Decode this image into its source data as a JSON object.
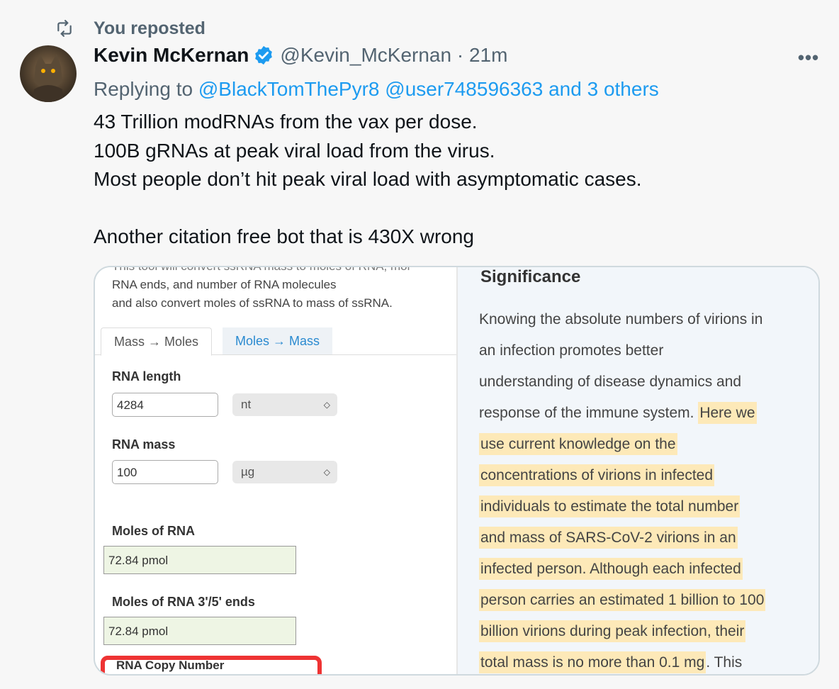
{
  "repost": {
    "text": "You reposted"
  },
  "author": {
    "name": "Kevin McKernan",
    "handle": "@Kevin_McKernan",
    "time_sep": " · ",
    "time": "21m"
  },
  "reply": {
    "prefix": "Replying to ",
    "mentions": [
      "@BlackTomThePyr8",
      "@user748596363",
      "and 3 others"
    ]
  },
  "tweet_lines": [
    "43 Trillion modRNAs from the vax per dose.",
    "100B gRNAs at peak viral load from the virus.",
    "Most people don’t hit peak viral load with asymptomatic cases.",
    "",
    "Another citation free bot that is 430X wrong"
  ],
  "media": {
    "calculator": {
      "intro_lines": [
        "This tool will convert ssRNA mass to moles of RNA, mol",
        "RNA ends, and number of RNA molecules",
        "and also convert moles of ssRNA to mass of ssRNA."
      ],
      "tabs": [
        "Mass → Moles",
        "Moles → Mass"
      ],
      "rna_length_label": "RNA length",
      "rna_length_value": "4284",
      "rna_length_unit": "nt",
      "rna_mass_label": "RNA mass",
      "rna_mass_value": "100",
      "rna_mass_unit": "µg",
      "moles_label": "Moles of RNA",
      "moles_value": "72.84 pmol",
      "ends_label": "Moles of RNA 3'/5' ends",
      "ends_value": "72.84 pmol",
      "copy_number_label": "RNA Copy Number"
    },
    "significance": {
      "title": "Significance",
      "lines": [
        {
          "plain": "Knowing the absolute numbers of virions in",
          "highlight": ""
        },
        {
          "plain": "an infection promotes better",
          "highlight": ""
        },
        {
          "plain": "understanding of disease dynamics and",
          "highlight": ""
        },
        {
          "plain": "response of the immune system. ",
          "highlight": "Here we"
        },
        {
          "plain": "",
          "highlight": "use current knowledge on the"
        },
        {
          "plain": "",
          "highlight": "concentrations of virions in infected"
        },
        {
          "plain": "",
          "highlight": "individuals to estimate the total number"
        },
        {
          "plain": "",
          "highlight": "and mass of SARS-CoV-2 virions in an"
        },
        {
          "plain": "",
          "highlight": "infected person. Although each infected"
        },
        {
          "plain": "",
          "highlight": "person carries an estimated 1 billion to 100"
        },
        {
          "plain": "",
          "highlight": "billion virions during peak infection, their"
        },
        {
          "plain": "",
          "highlight": "total mass is no more than 0.1 mg",
          "tail": ". This"
        }
      ]
    }
  }
}
